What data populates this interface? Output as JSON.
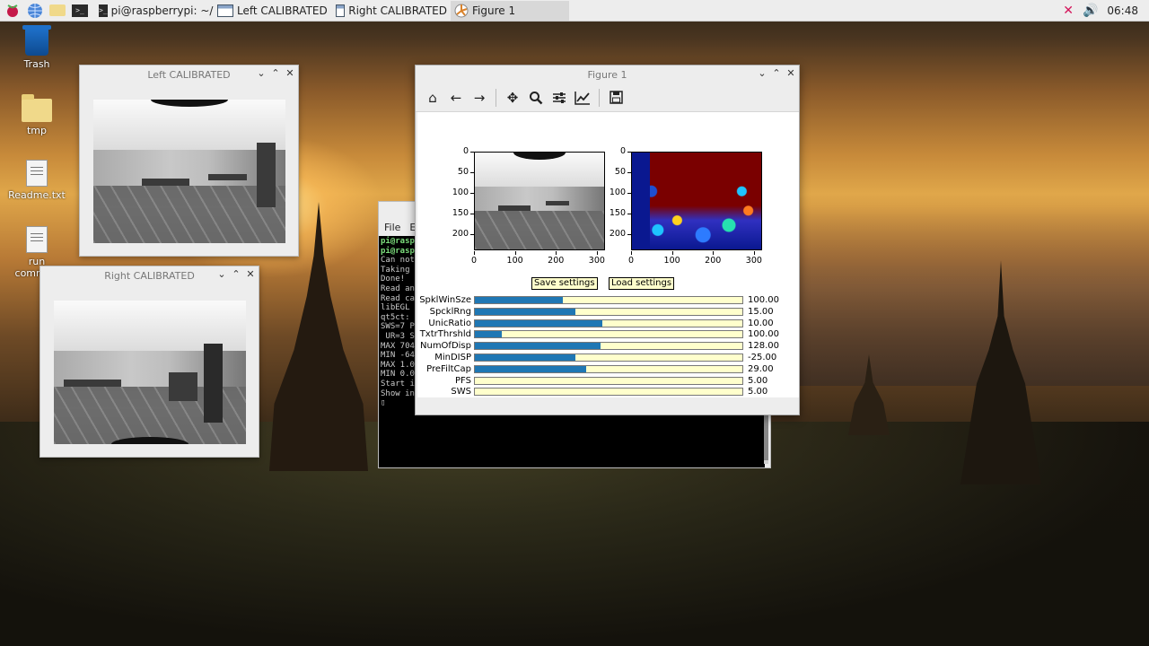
{
  "taskbar": {
    "buttons": [
      {
        "label": "pi@raspberrypi: ~/ste..."
      },
      {
        "label": "Left CALIBRATED"
      },
      {
        "label": "Right CALIBRATED"
      },
      {
        "label": "Figure 1"
      }
    ],
    "clock": "06:48"
  },
  "desktop": {
    "icons": [
      {
        "label": "Trash"
      },
      {
        "label": "tmp"
      },
      {
        "label": "Readme.txt"
      },
      {
        "label": "run",
        "label2": "comma"
      }
    ]
  },
  "left_window": {
    "title": "Left CALIBRATED"
  },
  "right_window": {
    "title": "Right CALIBRATED"
  },
  "terminal": {
    "menu": [
      "File",
      "E"
    ],
    "lines": [
      {
        "text": "pi@rasp",
        "prompt": true
      },
      {
        "text": "pi@rasp",
        "prompt": true
      },
      {
        "text": "Can not"
      },
      {
        "text": "Taking "
      },
      {
        "text": "Done!"
      },
      {
        "text": "Read an"
      },
      {
        "text": "Read ca"
      },
      {
        "text": "libEGL "
      },
      {
        "text": "qt5ct: "
      },
      {
        "text": "SWS=7 P"
      },
      {
        "text": " UR=3 S"
      },
      {
        "text": "MAX 704"
      },
      {
        "text": "MIN -64"
      },
      {
        "text": "MAX 1.0"
      },
      {
        "text": "MIN 0.0"
      },
      {
        "text": "Start i"
      },
      {
        "text": "Show in"
      },
      {
        "text": "▯"
      }
    ]
  },
  "figure": {
    "title": "Figure 1",
    "toolbar": [
      "home-icon",
      "back-icon",
      "forward-icon",
      "pan-icon",
      "zoom-icon",
      "configure-icon",
      "edit-axis-icon",
      "save-icon"
    ],
    "left_axes": {
      "yticks": [
        "0",
        "50",
        "100",
        "150",
        "200"
      ],
      "xticks": [
        "0",
        "100",
        "200",
        "300"
      ]
    },
    "right_axes": {
      "yticks": [
        "0",
        "50",
        "100",
        "150",
        "200"
      ],
      "xticks": [
        "0",
        "100",
        "200",
        "300"
      ]
    },
    "save_button": "Save settings",
    "load_button": "Load settings",
    "sliders": [
      {
        "label": "SpklWinSze",
        "value_text": "100.00",
        "fill": 0.33
      },
      {
        "label": "SpcklRng",
        "value_text": "15.00",
        "fill": 0.375
      },
      {
        "label": "UnicRatio",
        "value_text": "10.00",
        "fill": 0.475
      },
      {
        "label": "TxtrThrshld",
        "value_text": "100.00",
        "fill": 0.1
      },
      {
        "label": "NumOfDisp",
        "value_text": "128.00",
        "fill": 0.47
      },
      {
        "label": "MinDISP",
        "value_text": "-25.00",
        "fill": 0.375
      },
      {
        "label": "PreFiltCap",
        "value_text": "29.00",
        "fill": 0.415
      },
      {
        "label": "PFS",
        "value_text": "5.00",
        "fill": 0.0
      },
      {
        "label": "SWS",
        "value_text": "5.00",
        "fill": 0.0
      }
    ]
  },
  "colors": {
    "slider_fill": "#1f77b4",
    "slider_bg": "#ffffcc",
    "taskbar_bg": "#ededed"
  }
}
